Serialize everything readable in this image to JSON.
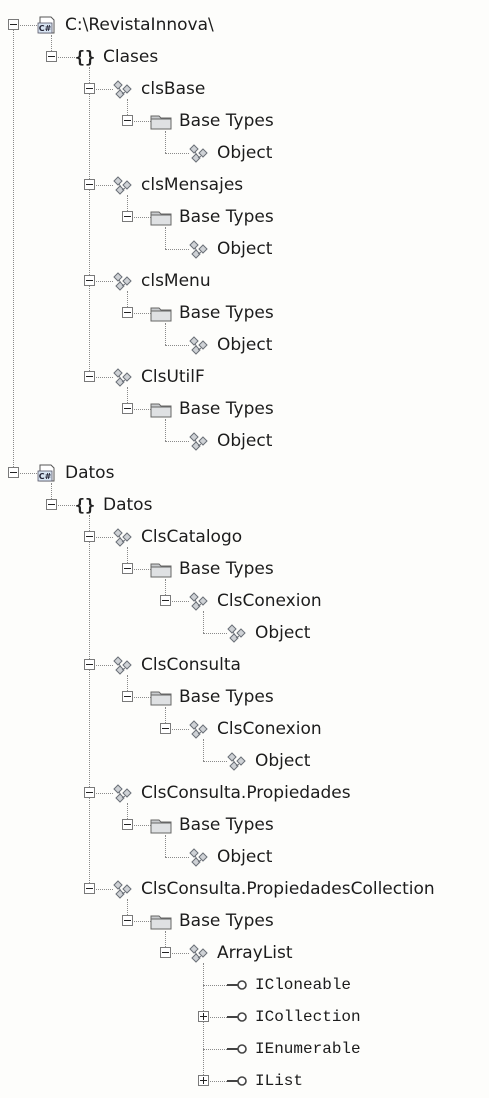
{
  "tree": [
    {
      "label": "C:\\RevistaInnova\\",
      "icon": "csharp-project-icon",
      "expanded": true,
      "children": [
        {
          "label": "Clases",
          "icon": "namespace-icon",
          "expanded": true,
          "children": [
            {
              "label": "clsBase",
              "icon": "class-icon",
              "expanded": true,
              "children": [
                {
                  "label": "Base Types",
                  "icon": "folder-icon",
                  "expanded": true,
                  "children": [
                    {
                      "label": "Object",
                      "icon": "class-icon"
                    }
                  ]
                }
              ]
            },
            {
              "label": "clsMensajes",
              "icon": "class-icon",
              "expanded": true,
              "children": [
                {
                  "label": "Base Types",
                  "icon": "folder-icon",
                  "expanded": true,
                  "children": [
                    {
                      "label": "Object",
                      "icon": "class-icon"
                    }
                  ]
                }
              ]
            },
            {
              "label": "clsMenu",
              "icon": "class-icon",
              "expanded": true,
              "children": [
                {
                  "label": "Base Types",
                  "icon": "folder-icon",
                  "expanded": true,
                  "children": [
                    {
                      "label": "Object",
                      "icon": "class-icon"
                    }
                  ]
                }
              ]
            },
            {
              "label": "ClsUtilF",
              "icon": "class-icon",
              "expanded": true,
              "children": [
                {
                  "label": "Base Types",
                  "icon": "folder-icon",
                  "expanded": true,
                  "children": [
                    {
                      "label": "Object",
                      "icon": "class-icon"
                    }
                  ]
                }
              ]
            }
          ]
        }
      ]
    },
    {
      "label": "Datos",
      "icon": "csharp-project-icon",
      "expanded": true,
      "children": [
        {
          "label": "Datos",
          "icon": "namespace-icon",
          "expanded": true,
          "children": [
            {
              "label": "ClsCatalogo",
              "icon": "class-icon",
              "expanded": true,
              "children": [
                {
                  "label": "Base Types",
                  "icon": "folder-icon",
                  "expanded": true,
                  "children": [
                    {
                      "label": "ClsConexion",
                      "icon": "class-icon",
                      "expanded": true,
                      "children": [
                        {
                          "label": "Object",
                          "icon": "class-icon"
                        }
                      ]
                    }
                  ]
                }
              ]
            },
            {
              "label": "ClsConsulta",
              "icon": "class-icon",
              "expanded": true,
              "children": [
                {
                  "label": "Base Types",
                  "icon": "folder-icon",
                  "expanded": true,
                  "children": [
                    {
                      "label": "ClsConexion",
                      "icon": "class-icon",
                      "expanded": true,
                      "children": [
                        {
                          "label": "Object",
                          "icon": "class-icon"
                        }
                      ]
                    }
                  ]
                }
              ]
            },
            {
              "label": "ClsConsulta.Propiedades",
              "icon": "class-icon",
              "expanded": true,
              "children": [
                {
                  "label": "Base Types",
                  "icon": "folder-icon",
                  "expanded": true,
                  "children": [
                    {
                      "label": "Object",
                      "icon": "class-icon"
                    }
                  ]
                }
              ]
            },
            {
              "label": "ClsConsulta.PropiedadesCollection",
              "icon": "class-icon",
              "expanded": true,
              "children": [
                {
                  "label": "Base Types",
                  "icon": "folder-icon",
                  "expanded": true,
                  "children": [
                    {
                      "label": "ArrayList",
                      "icon": "class-icon",
                      "expanded": true,
                      "children": [
                        {
                          "label": "ICloneable",
                          "icon": "interface-icon"
                        },
                        {
                          "label": "ICollection",
                          "icon": "interface-icon",
                          "expanded": false
                        },
                        {
                          "label": "IEnumerable",
                          "icon": "interface-icon"
                        },
                        {
                          "label": "IList",
                          "icon": "interface-icon",
                          "expanded": false
                        }
                      ]
                    }
                  ]
                }
              ]
            }
          ]
        }
      ]
    }
  ]
}
